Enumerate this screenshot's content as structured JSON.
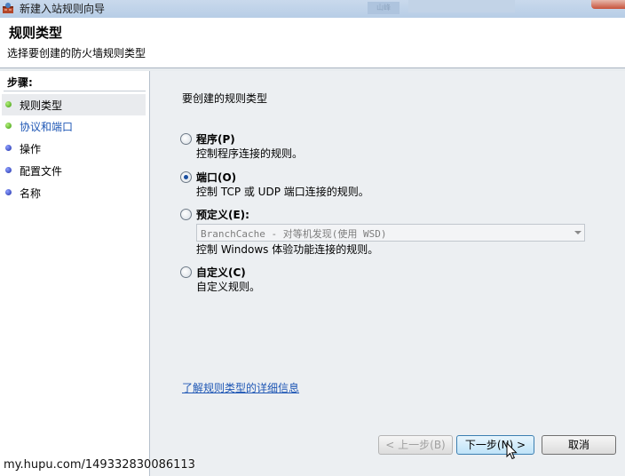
{
  "window": {
    "title": "新建入站规则向导",
    "ghost_tab": "山峰"
  },
  "header": {
    "title": "规则类型",
    "subtitle": "选择要创建的防火墙规则类型"
  },
  "sidebar": {
    "steps_label": "步骤:",
    "items": [
      {
        "label": "规则类型",
        "status": "green",
        "active": true
      },
      {
        "label": "协议和端口",
        "status": "green",
        "link": true
      },
      {
        "label": "操作",
        "status": "blue"
      },
      {
        "label": "配置文件",
        "status": "blue"
      },
      {
        "label": "名称",
        "status": "blue"
      }
    ]
  },
  "main": {
    "question": "要创建的规则类型",
    "options": [
      {
        "title": "程序(P)",
        "desc": "控制程序连接的规则。",
        "checked": false
      },
      {
        "title": "端口(O)",
        "desc": "控制 TCP 或 UDP 端口连接的规则。",
        "checked": true
      },
      {
        "title": "预定义(E):",
        "combo": "BranchCache - 对等机发现(使用 WSD)",
        "desc": "控制 Windows 体验功能连接的规则。",
        "checked": false
      },
      {
        "title": "自定义(C)",
        "desc": "自定义规则。",
        "checked": false
      }
    ],
    "learn_more": "了解规则类型的详细信息"
  },
  "buttons": {
    "back": "< 上一步(B)",
    "next": "下一步(N) >",
    "cancel": "取消"
  },
  "watermark": "my.hupu.com/149332830086113",
  "colors": {
    "link": "#1f57b5",
    "step_done": "#3b9a0b",
    "step_pending": "#1d2ea8"
  }
}
